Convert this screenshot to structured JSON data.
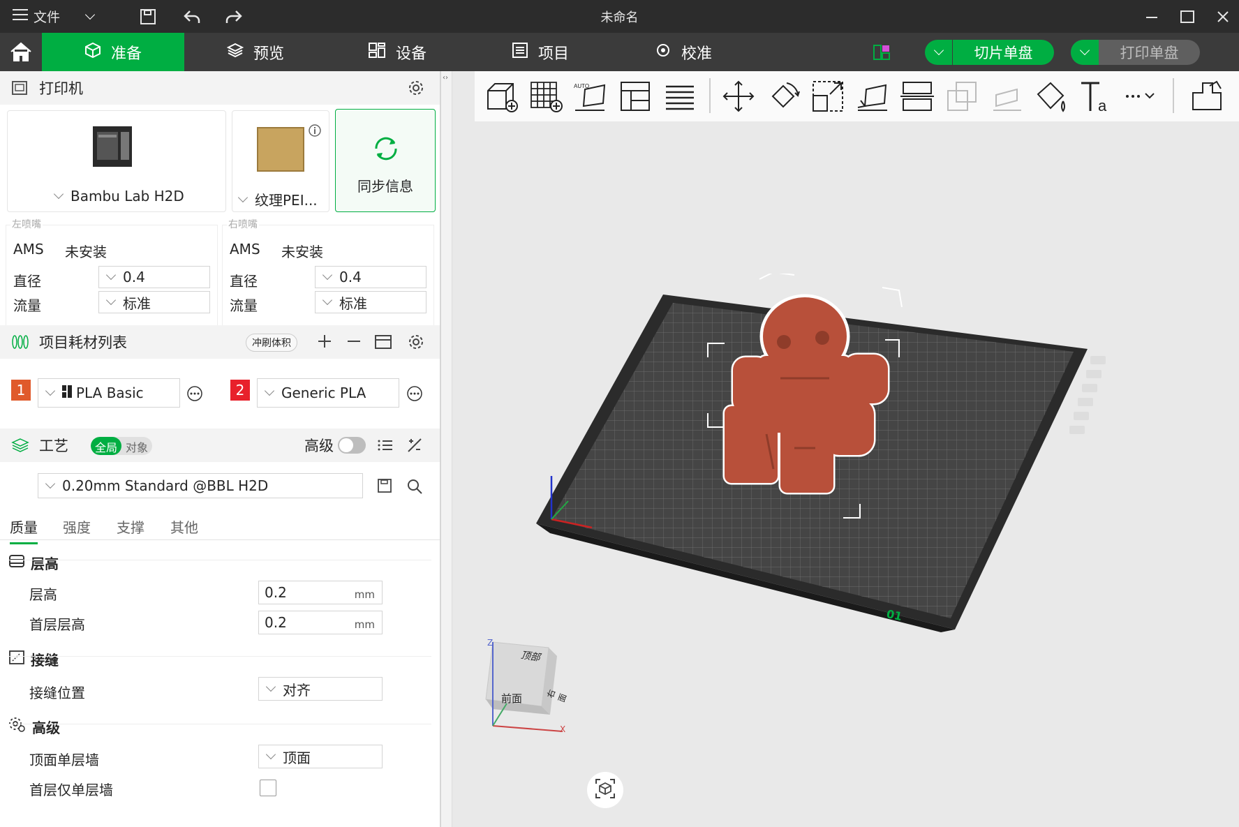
{
  "titlebar": {
    "menu_label": "文件",
    "window_title": "未命名"
  },
  "nav": {
    "tabs": [
      {
        "label": "准备",
        "icon": "cube-icon",
        "active": true
      },
      {
        "label": "预览",
        "icon": "layers-icon",
        "active": false
      },
      {
        "label": "设备",
        "icon": "device-icon",
        "active": false
      },
      {
        "label": "项目",
        "icon": "list-icon",
        "active": false
      },
      {
        "label": "校准",
        "icon": "calibrate-icon",
        "active": false
      }
    ],
    "slice_button": "切片单盘",
    "print_button": "打印单盘"
  },
  "printer": {
    "title": "打印机",
    "printer_name": "Bambu Lab H2D",
    "plate_name": "纹理PEI...",
    "sync_label": "同步信息",
    "left_nozzle": {
      "title": "左喷嘴",
      "ams_label": "AMS",
      "ams_value": "未安装",
      "diameter_label": "直径",
      "diameter_value": "0.4",
      "flow_label": "流量",
      "flow_value": "标准"
    },
    "right_nozzle": {
      "title": "右喷嘴",
      "ams_label": "AMS",
      "ams_value": "未安装",
      "diameter_label": "直径",
      "diameter_value": "0.4",
      "flow_label": "流量",
      "flow_value": "标准"
    }
  },
  "filament": {
    "title": "项目耗材列表",
    "flush_label": "冲刷体积",
    "items": [
      {
        "index": "1",
        "name": "PLA Basic",
        "color": "#e05a2b"
      },
      {
        "index": "2",
        "name": "Generic PLA",
        "color": "#e8212b"
      }
    ]
  },
  "process": {
    "title": "工艺",
    "toggle_global": "全局",
    "toggle_object": "对象",
    "advanced_label": "高级",
    "profile": "0.20mm Standard @BBL H2D",
    "tabs": [
      "质量",
      "强度",
      "支撑",
      "其他"
    ],
    "groups": {
      "layer_height": {
        "title": "层高",
        "layer_height_label": "层高",
        "layer_height_value": "0.2",
        "first_layer_label": "首层层高",
        "first_layer_value": "0.2",
        "unit": "mm"
      },
      "seam": {
        "title": "接缝",
        "position_label": "接缝位置",
        "position_value": "对齐"
      },
      "advanced": {
        "title": "高级",
        "top_wall_label": "顶面单层墙",
        "top_wall_value": "顶面",
        "first_layer_wall_label": "首层仅单层墙"
      }
    }
  },
  "viewcube": {
    "top": "顶部",
    "front": "前面",
    "right": "右面",
    "axis_z": "Z",
    "axis_x": "X"
  },
  "plate_label": "01",
  "accent_color": "#00ae42"
}
